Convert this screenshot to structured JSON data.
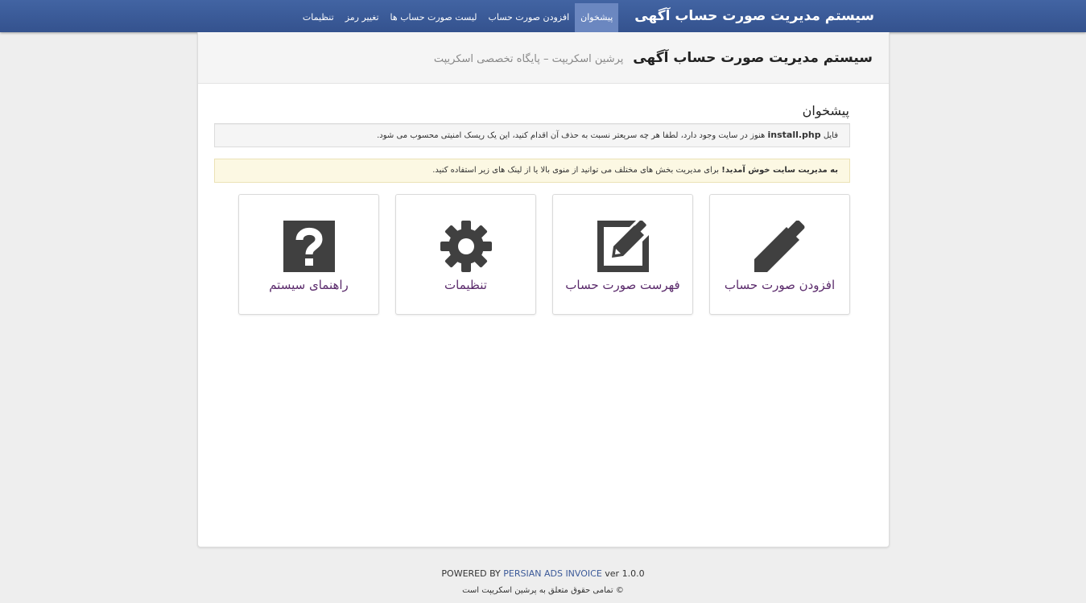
{
  "navbar": {
    "brand": "سیستم مدیریت صورت حساب آگهی",
    "items": [
      {
        "label": "پیشخوان",
        "active": true
      },
      {
        "label": "افزودن صورت حساب",
        "active": false
      },
      {
        "label": "لیست صورت حساب ها",
        "active": false
      },
      {
        "label": "تغییر رمز",
        "active": false
      },
      {
        "label": "تنظیمات",
        "active": false
      }
    ]
  },
  "header": {
    "title": "سیستم مدیریت صورت حساب آگهی",
    "subtitle": "پرشین اسکریپت – پایگاه تخصصی اسکریپت"
  },
  "dashboard": {
    "title": "پیشخوان",
    "well": {
      "prefix": "فایل",
      "filename": "install.php",
      "message": "هنوز در سایت وجود دارد، لطفا هر چه سریعتر نسبت به حذف آن اقدام کنید، این یک ریسک امنیتی محسوب می شود."
    },
    "alert": {
      "strong": "به مدیریت سایت خوش آمدید!",
      "message": "برای مدیریت بخش های مختلف می توانید از منوی بالا یا از لینک های زیر استفاده کنید."
    },
    "tiles": [
      {
        "label": "افزودن صورت حساب",
        "icon": "pencil-icon"
      },
      {
        "label": "فهرست صورت حساب",
        "icon": "edit-icon"
      },
      {
        "label": "تنظیمات",
        "icon": "gear-icon"
      },
      {
        "label": "راهنمای سیستم",
        "icon": "question-icon"
      }
    ]
  },
  "footer": {
    "powered_prefix": "POWERED BY",
    "powered_name": "PERSIAN ADS INVOICE",
    "version": "ver 1.0.0",
    "copyright": "© تمامی حقوق متعلق به پرشین اسکریپت است"
  },
  "colors": {
    "navbar": "#3b5998",
    "nav_active": "#6b87c0",
    "tile_label": "#5a2a6b",
    "icon": "#404040",
    "alert_bg": "#fcf8e3"
  }
}
